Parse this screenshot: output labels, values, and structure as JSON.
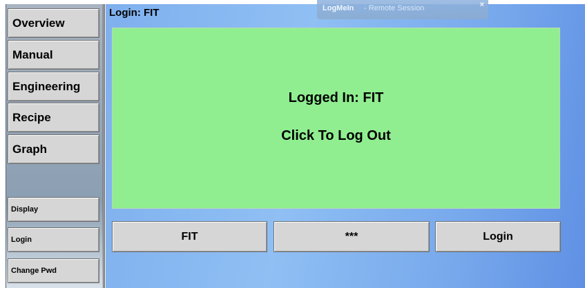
{
  "sidebar": {
    "nav_items": [
      {
        "label": "Overview"
      },
      {
        "label": "Manual"
      },
      {
        "label": "Engineering"
      },
      {
        "label": "Recipe"
      },
      {
        "label": "Graph"
      }
    ],
    "bottom_items": [
      {
        "label": "Display"
      },
      {
        "label": "Login"
      },
      {
        "label": "Change Pwd"
      }
    ]
  },
  "header": {
    "title": "Login: FIT"
  },
  "logmein": {
    "brand": "LogMeIn",
    "subtitle": "-  Remote Session",
    "close_glyph": "×"
  },
  "status": {
    "line1": "Logged In: FIT",
    "line2": "Click To Log Out",
    "color": "#90ee90"
  },
  "login_form": {
    "username": "FIT",
    "password": "***",
    "submit_label": "Login"
  },
  "colors": {
    "background_blue": "#7fb0ee",
    "button_gray": "#d6d6d6"
  }
}
